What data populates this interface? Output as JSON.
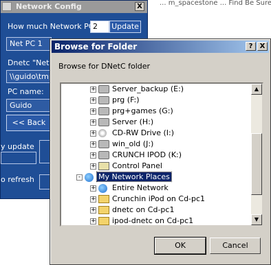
{
  "background": {
    "text": "... m_spacestone ...   Find Be Sure..."
  },
  "network_config": {
    "title": "Network Config",
    "close_glyph": "X",
    "pc_count_label": "How much Network PC's:",
    "pc_count_value": "2",
    "update_label": "Update",
    "selected_pc": "Net PC 1",
    "dnetc_label": "Dnetc \"Netw",
    "dnetc_path": "\\\\guido\\tmp",
    "pc_name_label": "PC name:",
    "pc_name_value": "Guido",
    "back_label": "<< Back",
    "auto_update_label": "y update",
    "refresh_label": "o refresh"
  },
  "browse_dialog": {
    "title": "Browse for Folder",
    "help_glyph": "?",
    "close_glyph": "X",
    "prompt": "Browse for DNetC folder",
    "items": [
      {
        "label": "Server_backup (E:)",
        "icon": "drive-icon",
        "indent": 1,
        "expander": "+"
      },
      {
        "label": "prg (F:)",
        "icon": "drive-icon",
        "indent": 1,
        "expander": "+"
      },
      {
        "label": "prg+games (G:)",
        "icon": "drive-icon",
        "indent": 1,
        "expander": "+"
      },
      {
        "label": "Server (H:)",
        "icon": "drive-icon",
        "indent": 1,
        "expander": "+"
      },
      {
        "label": "CD-RW Drive (I:)",
        "icon": "cd-drive-icon",
        "indent": 1,
        "expander": "+"
      },
      {
        "label": "win_old (J:)",
        "icon": "drive-icon",
        "indent": 1,
        "expander": "+"
      },
      {
        "label": "CRUNCH IPOD (K:)",
        "icon": "drive-icon",
        "indent": 1,
        "expander": "+"
      },
      {
        "label": "Control Panel",
        "icon": "control-panel-icon",
        "indent": 1,
        "expander": "+"
      },
      {
        "label": "My Network Places",
        "icon": "network-places-icon",
        "indent": 0,
        "expander": "-",
        "selected": true
      },
      {
        "label": "Entire Network",
        "icon": "globe-icon",
        "indent": 1,
        "expander": "+"
      },
      {
        "label": "Crunchin iPod on Cd-pc1",
        "icon": "network-share-icon",
        "indent": 1,
        "expander": "+"
      },
      {
        "label": "dnetc on Cd-pc1",
        "icon": "network-share-icon",
        "indent": 1,
        "expander": "+"
      },
      {
        "label": "ipod-dnetc on Cd-pc1",
        "icon": "network-share-icon",
        "indent": 1,
        "expander": "+"
      }
    ],
    "ok_label": "OK",
    "cancel_label": "Cancel"
  }
}
